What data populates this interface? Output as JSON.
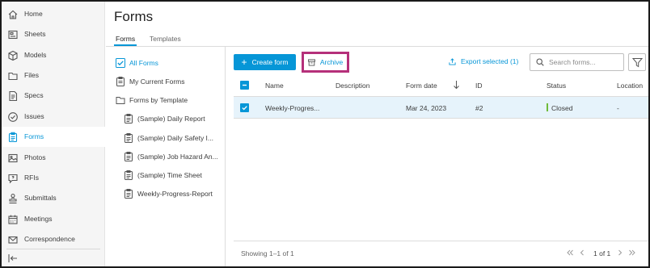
{
  "nav": {
    "items": [
      {
        "label": "Home",
        "icon": "home-icon"
      },
      {
        "label": "Sheets",
        "icon": "sheets-icon"
      },
      {
        "label": "Models",
        "icon": "cube-icon"
      },
      {
        "label": "Files",
        "icon": "folder-icon"
      },
      {
        "label": "Specs",
        "icon": "specs-icon"
      },
      {
        "label": "Issues",
        "icon": "check-circle-icon"
      },
      {
        "label": "Forms",
        "icon": "clipboard-icon",
        "active": true
      },
      {
        "label": "Photos",
        "icon": "photo-icon"
      },
      {
        "label": "RFIs",
        "icon": "chat-question-icon"
      },
      {
        "label": "Submittals",
        "icon": "stamp-icon"
      },
      {
        "label": "Meetings",
        "icon": "calendar-icon"
      },
      {
        "label": "Correspondence",
        "icon": "envelope-icon"
      }
    ],
    "collapse_icon": "collapse-left-icon"
  },
  "header": {
    "title": "Forms",
    "tabs": [
      {
        "label": "Forms",
        "active": true
      },
      {
        "label": "Templates"
      }
    ]
  },
  "tree": {
    "all_forms": "All Forms",
    "my_current_forms": "My Current Forms",
    "by_template": "Forms by Template",
    "templates": [
      "(Sample) Daily Report",
      "(Sample) Daily Safety I...",
      "(Sample) Job Hazard An...",
      "(Sample) Time Sheet",
      "Weekly-Progress-Report"
    ]
  },
  "toolbar": {
    "create_label": "Create form",
    "archive_label": "Archive",
    "export_label": "Export selected (1)",
    "search_placeholder": "Search forms..."
  },
  "table": {
    "headers": [
      "Name",
      "Description",
      "Form date",
      "ID",
      "Status",
      "Location"
    ],
    "rows": [
      {
        "name": "Weekly-Progres...",
        "description": "",
        "form_date": "Mar 24, 2023",
        "id": "#2",
        "status": "Closed",
        "location": "-"
      }
    ]
  },
  "footer": {
    "showing": "Showing 1–1 of 1",
    "pages": "1 of 1"
  },
  "colors": {
    "accent": "#0696d7",
    "highlight": "#b5307a",
    "status_closed": "#6fbb3a"
  }
}
